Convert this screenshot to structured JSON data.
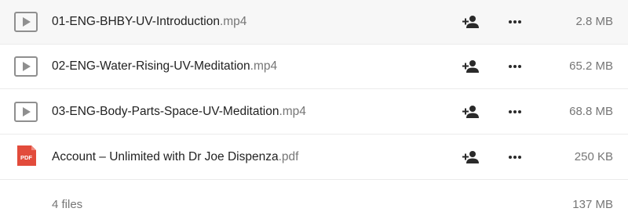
{
  "files": [
    {
      "type": "video",
      "icon": "video-file-icon",
      "basename": "01-ENG-BHBY-UV-Introduction",
      "extension": ".mp4",
      "size": "2.8 MB"
    },
    {
      "type": "video",
      "icon": "video-file-icon",
      "basename": "02-ENG-Water-Rising-UV-Meditation",
      "extension": ".mp4",
      "size": "65.2 MB"
    },
    {
      "type": "video",
      "icon": "video-file-icon",
      "basename": "03-ENG-Body-Parts-Space-UV-Meditation",
      "extension": ".mp4",
      "size": "68.8 MB"
    },
    {
      "type": "pdf",
      "icon": "pdf-file-icon",
      "icon_label": "PDF",
      "basename": "Account – Unlimited with Dr Joe Dispenza",
      "extension": ".pdf",
      "size": "250 KB"
    }
  ],
  "actions": {
    "share_icon": "add-person-icon",
    "more_icon": "more-options-icon"
  },
  "summary": {
    "file_count": "4 files",
    "total_size": "137 MB"
  },
  "colors": {
    "text_primary": "#222222",
    "text_secondary": "#767676",
    "pdf_red": "#e24b3b",
    "video_icon": "#8f8f8f"
  }
}
